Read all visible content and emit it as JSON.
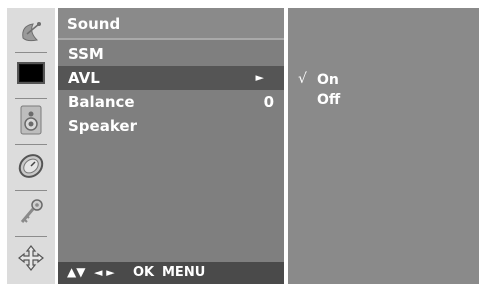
{
  "menu": {
    "title": "Sound",
    "items": [
      {
        "label": "SSM",
        "value": "",
        "arrow": "",
        "selected": false
      },
      {
        "label": "AVL",
        "value": "",
        "arrow": "►",
        "selected": true
      },
      {
        "label": "Balance",
        "value": "0",
        "arrow": "",
        "selected": false
      },
      {
        "label": "Speaker",
        "value": "",
        "arrow": "",
        "selected": false
      }
    ]
  },
  "nav_hints": {
    "updown": "▲▼",
    "leftright": "◄ ►",
    "ok": "OK",
    "menu": "MENU"
  },
  "submenu": {
    "items": [
      {
        "label": "On",
        "checked": true,
        "check_mark": "√"
      },
      {
        "label": "Off",
        "checked": false,
        "check_mark": ""
      }
    ]
  },
  "icons": [
    {
      "name": "satellite-dish-icon",
      "active": false
    },
    {
      "name": "picture-screen-icon",
      "active": false
    },
    {
      "name": "speaker-icon",
      "active": true
    },
    {
      "name": "clock-icon",
      "active": false
    },
    {
      "name": "key-icon",
      "active": false
    },
    {
      "name": "setup-arrows-icon",
      "active": false
    }
  ],
  "colors": {
    "menu_bg": "#7f7f7f",
    "selected_row": "#555555",
    "submenu_bg": "#8a8a8a",
    "icon_column_bg": "#dcdcdc",
    "text": "#ffffff"
  }
}
